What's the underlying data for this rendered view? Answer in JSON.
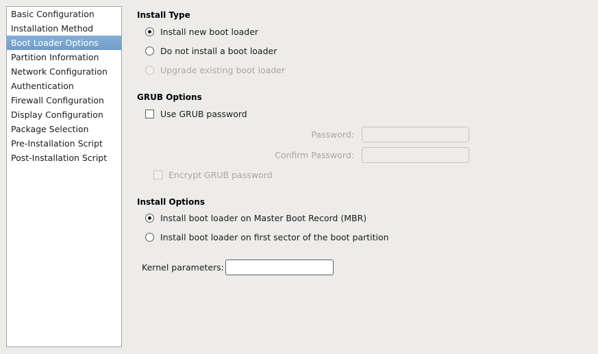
{
  "sidebar": {
    "items": [
      {
        "label": "Basic Configuration",
        "selected": false
      },
      {
        "label": "Installation Method",
        "selected": false
      },
      {
        "label": "Boot Loader Options",
        "selected": true
      },
      {
        "label": "Partition Information",
        "selected": false
      },
      {
        "label": "Network Configuration",
        "selected": false
      },
      {
        "label": "Authentication",
        "selected": false
      },
      {
        "label": "Firewall Configuration",
        "selected": false
      },
      {
        "label": "Display Configuration",
        "selected": false
      },
      {
        "label": "Package Selection",
        "selected": false
      },
      {
        "label": "Pre-Installation Script",
        "selected": false
      },
      {
        "label": "Post-Installation Script",
        "selected": false
      }
    ],
    "selected_color": "#7ba6ce"
  },
  "main": {
    "install_type": {
      "title": "Install Type",
      "options": [
        {
          "label": "Install new boot loader",
          "checked": true,
          "disabled": false
        },
        {
          "label": "Do not install a boot loader",
          "checked": false,
          "disabled": false
        },
        {
          "label": "Upgrade existing boot loader",
          "checked": false,
          "disabled": true
        }
      ]
    },
    "grub_options": {
      "title": "GRUB Options",
      "use_grub_password": {
        "label": "Use GRUB password",
        "checked": false,
        "disabled": false
      },
      "password": {
        "label": "Password:",
        "value": "",
        "placeholder": "",
        "disabled": true
      },
      "confirm_password": {
        "label": "Confirm Password:",
        "value": "",
        "placeholder": "",
        "disabled": true
      },
      "encrypt_grub_password": {
        "label": "Encrypt GRUB password",
        "checked": false,
        "disabled": true
      }
    },
    "install_options": {
      "title": "Install Options",
      "options": [
        {
          "label": "Install boot loader on Master Boot Record (MBR)",
          "checked": true,
          "disabled": false
        },
        {
          "label": "Install boot loader on first sector of the boot partition",
          "checked": false,
          "disabled": false
        }
      ]
    },
    "kernel_parameters": {
      "label": "Kernel parameters:",
      "value": "",
      "placeholder": "",
      "disabled": false
    }
  }
}
